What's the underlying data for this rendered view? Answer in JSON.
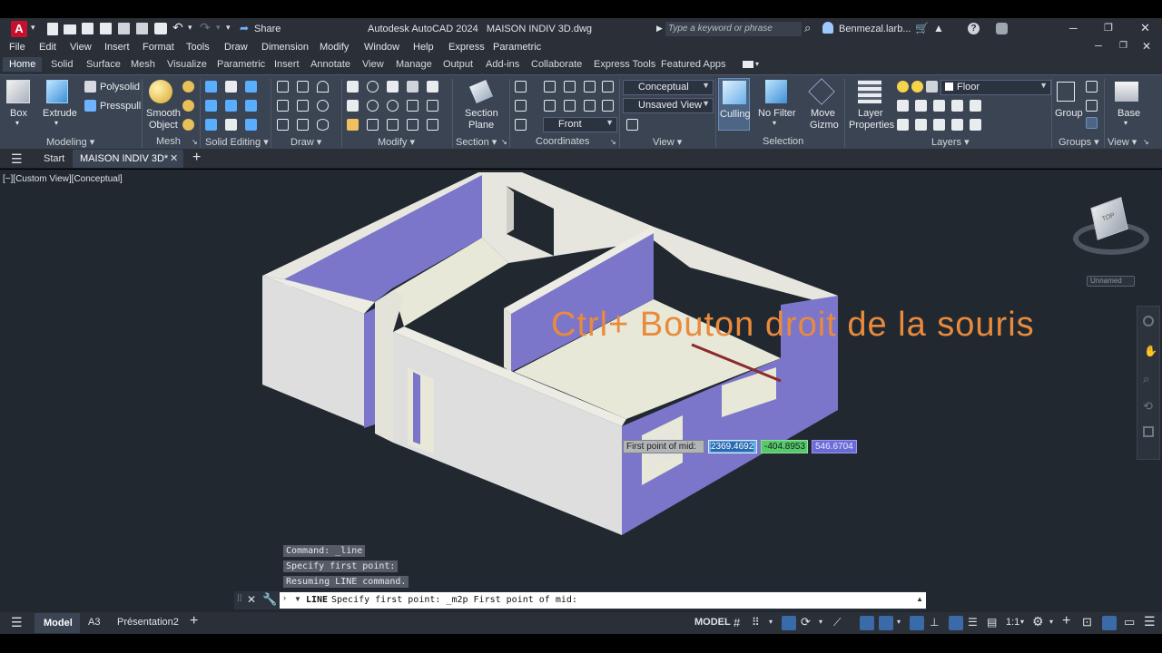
{
  "title": {
    "app": "Autodesk AutoCAD 2024",
    "file": "MAISON INDIV 3D.dwg",
    "share": "Share",
    "search_placeholder": "Type a keyword or phrase",
    "user": "Benmezal.larb..."
  },
  "menu": [
    "File",
    "Edit",
    "View",
    "Insert",
    "Format",
    "Tools",
    "Draw",
    "Dimension",
    "Modify",
    "Window",
    "Help",
    "Express",
    "Parametric"
  ],
  "ribbon_tabs": [
    "Home",
    "Solid",
    "Surface",
    "Mesh",
    "Visualize",
    "Parametric",
    "Insert",
    "Annotate",
    "View",
    "Manage",
    "Output",
    "Add-ins",
    "Collaborate",
    "Express Tools",
    "Featured Apps"
  ],
  "ribbon": {
    "box": "Box",
    "extrude": "Extrude",
    "polysolid": "Polysolid",
    "presspull": "Presspull",
    "smooth1": "Smooth",
    "smooth2": "Object",
    "section1": "Section",
    "section2": "Plane",
    "visual_style": "Conceptual",
    "saved_view": "Unsaved View",
    "ucs": "Front",
    "culling": "Culling",
    "no_filter": "No Filter",
    "move1": "Move",
    "move2": "Gizmo",
    "layer1": "Layer",
    "layer2": "Properties",
    "layer_current": "Floor",
    "group": "Group",
    "base": "Base",
    "panels": {
      "modeling": "Modeling",
      "mesh": "Mesh",
      "solid_editing": "Solid Editing",
      "draw": "Draw",
      "modify": "Modify",
      "section": "Section",
      "coordinates": "Coordinates",
      "view": "View",
      "selection": "Selection",
      "layers": "Layers",
      "groups": "Groups",
      "view2": "View"
    }
  },
  "doc_tabs": {
    "start": "Start",
    "active": "MAISON INDIV 3D*"
  },
  "viewport": {
    "label": "[−][Custom View][Conceptual]",
    "overlay": "Ctrl+ Bouton droit de la souris",
    "prompt_label": "First point of mid:",
    "coord_x": "2369.4692",
    "coord_y": "-404.8953",
    "coord_z": "546.6704",
    "viewcube_label": "Unnamed",
    "viewcube_top": "TOP"
  },
  "command_history": [
    "Command: _line",
    "Specify first point:",
    "Resuming LINE command."
  ],
  "command_line": {
    "cmd": "LINE",
    "text": "Specify first point: _m2p First point of mid:"
  },
  "layout_tabs": [
    "Model",
    "A3",
    "Présentation2"
  ],
  "status": {
    "model": "MODEL",
    "scale": "1:1"
  },
  "colors": {
    "wall_purple": "#7b76c9",
    "wall_white": "#e6e6df",
    "floor": "#e8e8d8",
    "overlay_text": "#e98a3c",
    "bg": "#212830"
  }
}
